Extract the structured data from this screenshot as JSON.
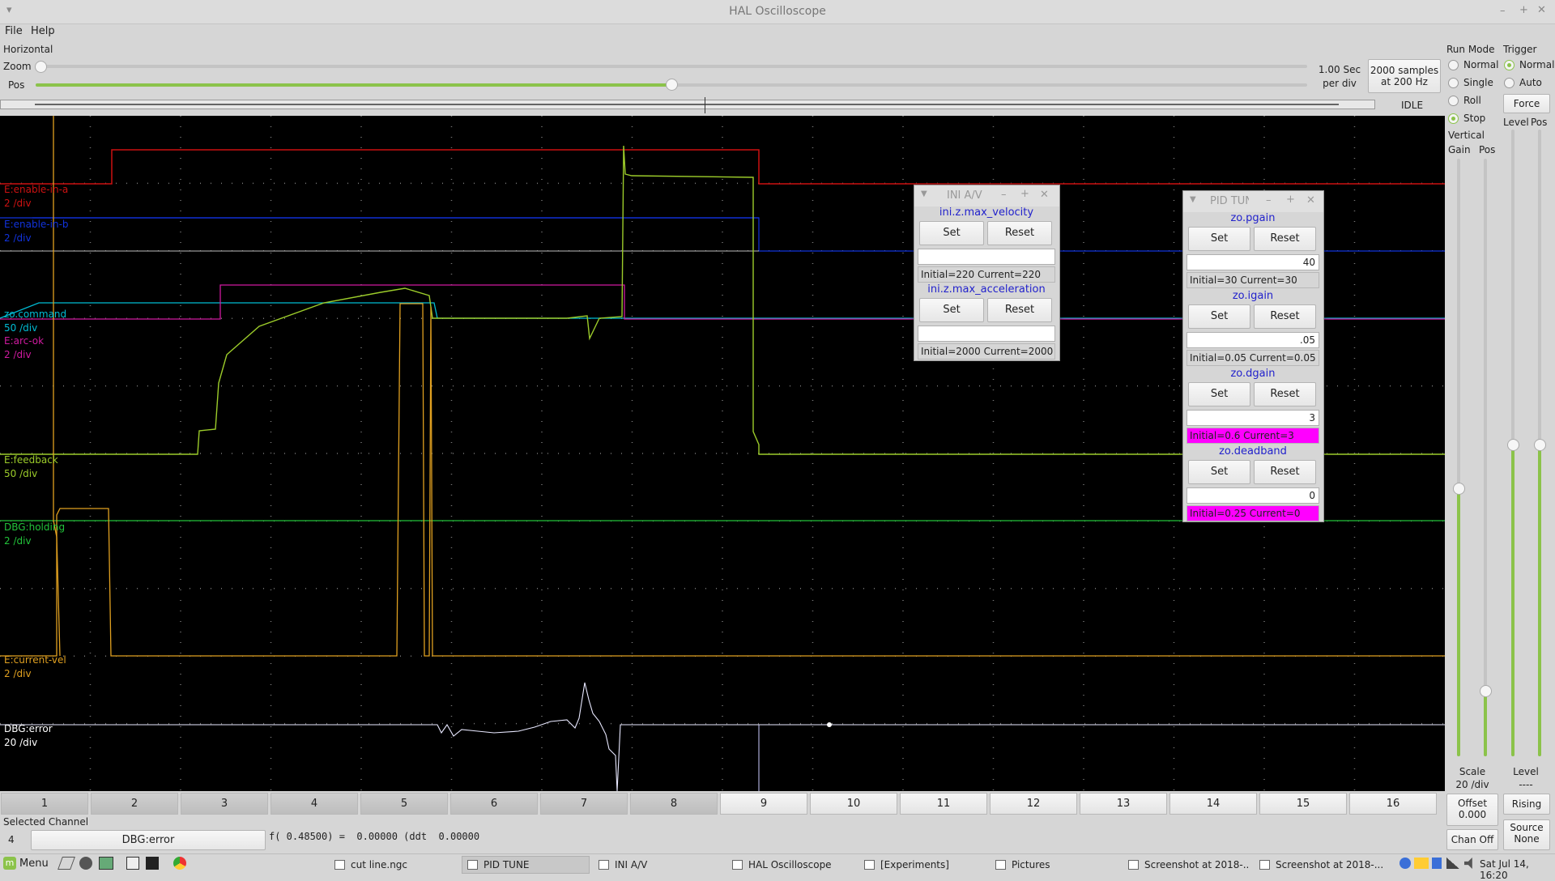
{
  "window": {
    "title": "HAL Oscilloscope"
  },
  "menu": {
    "file": "File",
    "help": "Help"
  },
  "horizontal": {
    "section_label": "Horizontal",
    "zoom_label": "Zoom",
    "pos_label": "Pos",
    "zoom_value": 0.0,
    "pos_value": 0.5,
    "rate_line1": "1.00 Sec",
    "rate_line2": "per div",
    "samples_line1": "2000 samples",
    "samples_line2": "at 200 Hz",
    "state": "IDLE"
  },
  "run_mode": {
    "label": "Run Mode",
    "options": [
      "Normal",
      "Single",
      "Roll",
      "Stop"
    ],
    "selected": "Stop"
  },
  "trigger": {
    "label": "Trigger",
    "options": [
      "Normal",
      "Auto"
    ],
    "selected": "Normal",
    "force": "Force",
    "level_label": "Level",
    "pos_label": "Pos",
    "bottom_level_label": "Level",
    "bottom_level_value": "----",
    "rising": "Rising",
    "source_label": "Source",
    "source_value": "None"
  },
  "vertical": {
    "label": "Vertical",
    "gain_label": "Gain",
    "pos_label": "Pos",
    "scale_label": "Scale",
    "scale_value": "20 /div",
    "offset_label": "Offset",
    "offset_value": "0.000",
    "chan_off": "Chan Off"
  },
  "traces": [
    {
      "name": "E:enable-in-a",
      "scale": "2 /div",
      "color": "#cc1111"
    },
    {
      "name": "E:enable-in-b",
      "scale": "2 /div",
      "color": "#1133dd"
    },
    {
      "name": "zo.command",
      "scale": "50 /div",
      "color": "#00bcd4"
    },
    {
      "name": "E:arc-ok",
      "scale": "2 /div",
      "color": "#d01aa0"
    },
    {
      "name": "E:feedback",
      "scale": "50 /div",
      "color": "#9ccc2a"
    },
    {
      "name": "DBG:holding",
      "scale": "2 /div",
      "color": "#22c33a"
    },
    {
      "name": "E:current-vel",
      "scale": "2 /div",
      "color": "#e0a020"
    },
    {
      "name": "DBG:error",
      "scale": "20 /div",
      "color": "#ffffff"
    }
  ],
  "channels": [
    "1",
    "2",
    "3",
    "4",
    "5",
    "6",
    "7",
    "8",
    "9",
    "10",
    "11",
    "12",
    "13",
    "14",
    "15",
    "16"
  ],
  "selected_channel": {
    "label": "Selected Channel",
    "number": "4",
    "name": "DBG:error",
    "readout": "f( 0.48500) =  0.00000 (ddt  0.00000"
  },
  "ini_window": {
    "title": "INI A/V",
    "params": [
      {
        "name": "ini.z.max_velocity",
        "set": "Set",
        "reset": "Reset",
        "value": "",
        "status": "Initial=220 Current=220",
        "changed": false
      },
      {
        "name": "ini.z.max_acceleration",
        "set": "Set",
        "reset": "Reset",
        "value": "",
        "status": "Initial=2000 Current=2000",
        "changed": false
      }
    ]
  },
  "pid_window": {
    "title": "PID TUNE",
    "params": [
      {
        "name": "zo.pgain",
        "set": "Set",
        "reset": "Reset",
        "value": "40",
        "status": "Initial=30 Current=30",
        "changed": false
      },
      {
        "name": "zo.igain",
        "set": "Set",
        "reset": "Reset",
        "value": ".05",
        "status": "Initial=0.05 Current=0.05",
        "changed": false
      },
      {
        "name": "zo.dgain",
        "set": "Set",
        "reset": "Reset",
        "value": "3",
        "status": "Initial=0.6 Current=3",
        "changed": true
      },
      {
        "name": "zo.deadband",
        "set": "Set",
        "reset": "Reset",
        "value": "0",
        "status": "Initial=0.25 Current=0",
        "changed": true
      }
    ]
  },
  "taskbar": {
    "menu": "Menu",
    "tasks": [
      "cut line.ngc",
      "PID TUNE",
      "INI A/V",
      "HAL Oscilloscope",
      "[Experiments]",
      "Pictures",
      "Screenshot at 2018-...",
      "Screenshot at 2018-..."
    ],
    "active_task": "PID TUNE",
    "clock": "Sat Jul 14, 16:20"
  }
}
